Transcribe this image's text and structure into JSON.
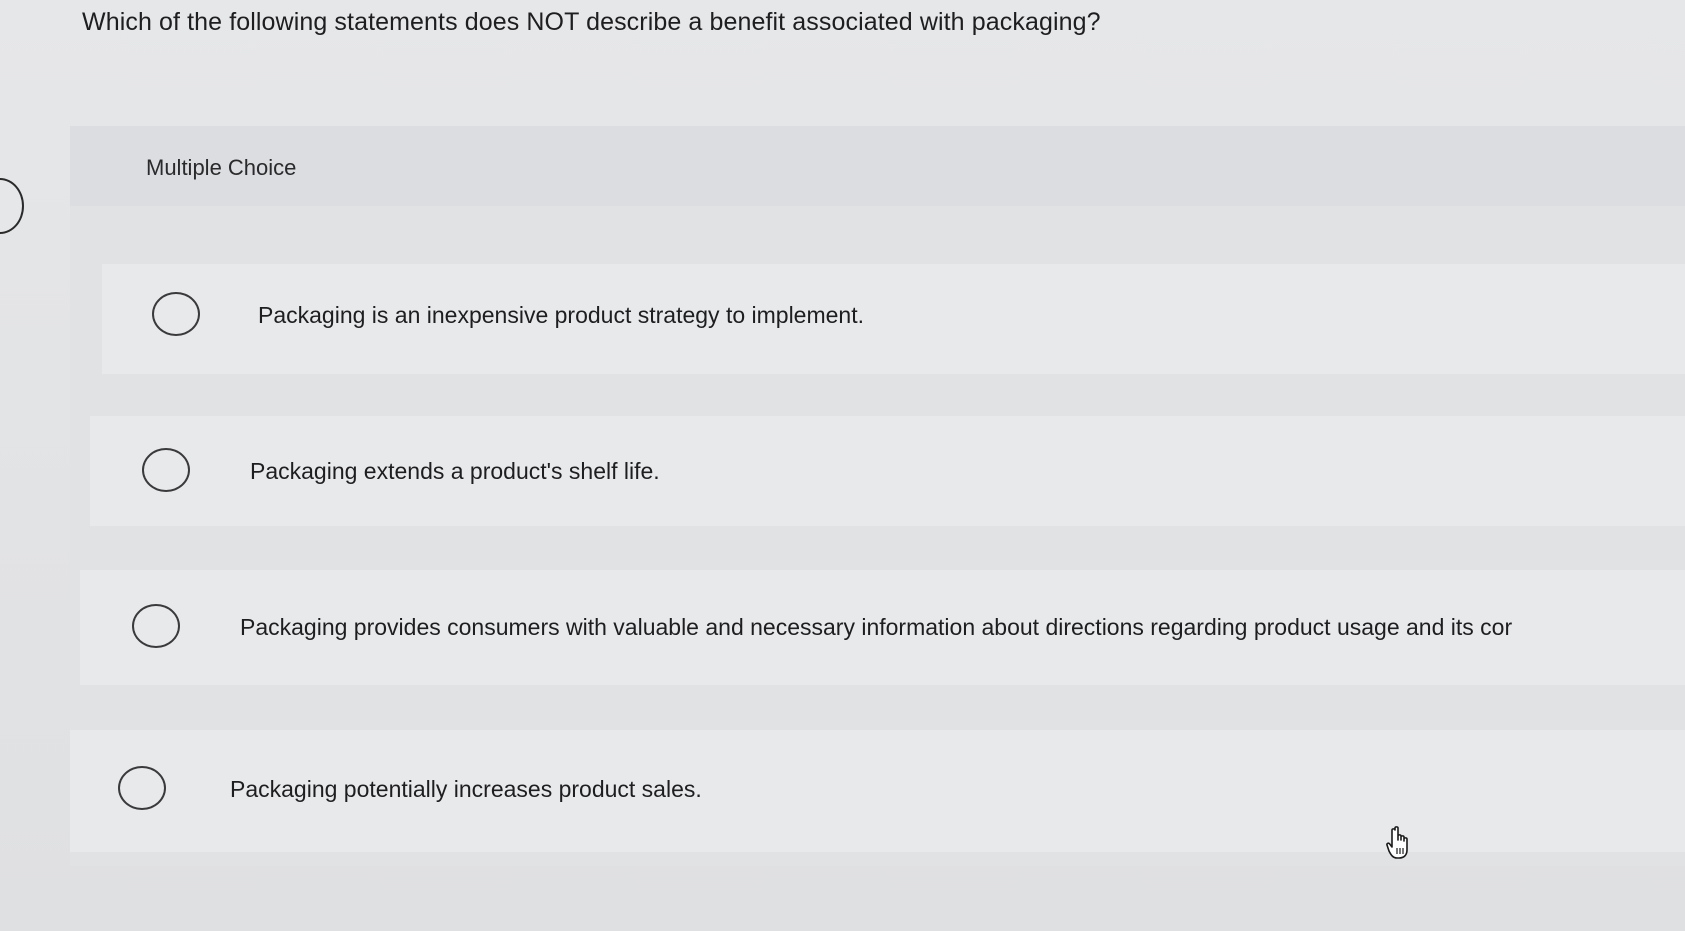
{
  "question": {
    "text": "Which of the following statements does NOT describe a benefit associated with packaging?"
  },
  "section": {
    "label": "Multiple Choice"
  },
  "choices": [
    {
      "text": "Packaging is an inexpensive product strategy to implement.",
      "selected": false
    },
    {
      "text": "Packaging extends a product's shelf life.",
      "selected": false
    },
    {
      "text": "Packaging provides consumers with valuable and necessary information about directions regarding product usage and its cor",
      "selected": false
    },
    {
      "text": "Packaging potentially increases product sales.",
      "selected": false
    }
  ],
  "cursor": {
    "icon": "hand-pointer-icon"
  }
}
